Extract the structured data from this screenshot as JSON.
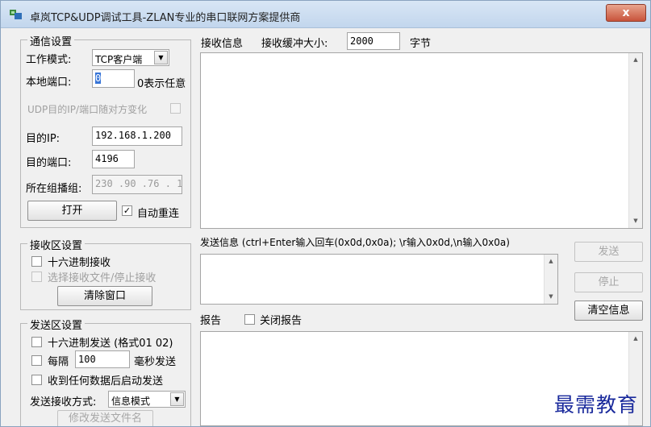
{
  "window": {
    "title": "卓岚TCP&UDP调试工具-ZLAN专业的串口联网方案提供商",
    "close_label": "x",
    "app_icon": "app-logo-icon"
  },
  "comm": {
    "title": "通信设置",
    "mode_label": "工作模式:",
    "mode_value": "TCP客户端",
    "local_port_label": "本地端口:",
    "local_port_value": "0",
    "local_port_hint": "0表示任意",
    "udp_follow_label": "UDP目的IP/端口随对方变化",
    "dest_ip_label": "目的IP:",
    "dest_ip_value": "192.168.1.200",
    "dest_port_label": "目的端口:",
    "dest_port_value": "4196",
    "multicast_label": "所在组播组:",
    "multicast_value": "230 .90 .76 . 1",
    "open_button": "打开",
    "auto_reconnect_label": "自动重连",
    "auto_reconnect_checked": true
  },
  "recv_settings": {
    "title": "接收区设置",
    "hex_recv_label": "十六进制接收",
    "recv_file_label": "选择接收文件/停止接收",
    "clear_button": "清除窗口"
  },
  "send_settings": {
    "title": "发送区设置",
    "hex_send_label": "十六进制发送 (格式01 02)",
    "every_label": "每隔",
    "interval_value": "100",
    "ms_label": "毫秒发送",
    "trigger_label": "收到任何数据后启动发送",
    "mode_label": "发送接收方式:",
    "mode_value": "信息模式",
    "modify_file_button": "修改发送文件名"
  },
  "recv_panel": {
    "label": "接收信息",
    "buffer_label": "接收缓冲大小:",
    "buffer_value": "2000",
    "unit": "字节"
  },
  "send_panel": {
    "label": "发送信息 (ctrl+Enter输入回车(0x0d,0x0a); \\r输入0x0d,\\n输入0x0a)",
    "send_button": "发送",
    "stop_button": "停止",
    "clear_info_button": "清空信息"
  },
  "report_panel": {
    "label": "报告",
    "close_report_label": "关闭报告"
  },
  "watermark": "最需教育"
}
